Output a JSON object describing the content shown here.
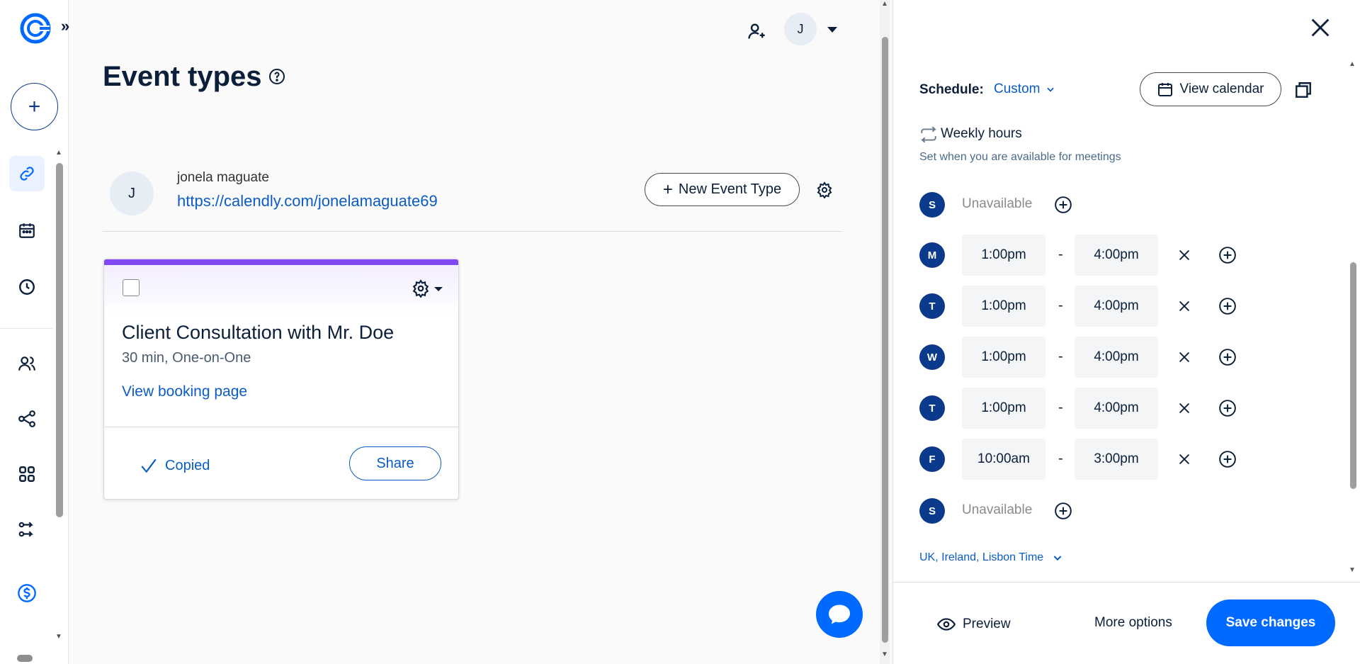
{
  "header": {
    "page_title": "Event types",
    "avatar_initial": "J"
  },
  "user": {
    "initial": "J",
    "name": "jonela maguate",
    "link": "https://calendly.com/jonelamaguate69",
    "new_event_label": "New Event Type"
  },
  "event_card": {
    "title": "Client Consultation with Mr. Doe",
    "meta": "30 min, One-on-One",
    "booking_link": "View booking page",
    "copied_label": "Copied",
    "share_label": "Share",
    "accent_color": "#8247f5"
  },
  "panel": {
    "schedule_label": "Schedule:",
    "schedule_value": "Custom",
    "view_calendar_label": "View calendar",
    "weekly_title": "Weekly hours",
    "weekly_subtitle": "Set when you are available for meetings",
    "days": [
      {
        "letter": "S",
        "unavailable": "Unavailable"
      },
      {
        "letter": "M",
        "start": "1:00pm",
        "end": "4:00pm"
      },
      {
        "letter": "T",
        "start": "1:00pm",
        "end": "4:00pm"
      },
      {
        "letter": "W",
        "start": "1:00pm",
        "end": "4:00pm"
      },
      {
        "letter": "T",
        "start": "1:00pm",
        "end": "4:00pm"
      },
      {
        "letter": "F",
        "start": "10:00am",
        "end": "3:00pm"
      },
      {
        "letter": "S",
        "unavailable": "Unavailable"
      }
    ],
    "dash": "-",
    "timezone": "UK, Ireland, Lisbon Time",
    "preview_label": "Preview",
    "more_options_label": "More options",
    "save_label": "Save changes"
  },
  "colors": {
    "brand_blue": "#0069ff",
    "link_blue": "#0b5cc4",
    "navy": "#0b1f3a",
    "day_badge": "#0b3a8c"
  }
}
